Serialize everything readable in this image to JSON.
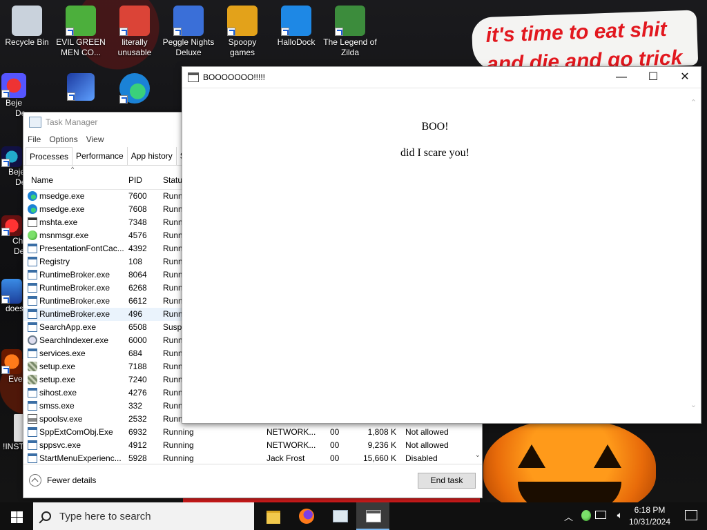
{
  "desktop": {
    "icons_row1": [
      {
        "label": "Recycle Bin",
        "color": "#c9d2dc"
      },
      {
        "label": "EVIL GREEN MEN CO...",
        "color": "#4caf3c"
      },
      {
        "label": "literally unusable",
        "color": "#db4437"
      },
      {
        "label": "Peggle Nights Deluxe",
        "color": "#3a6fd8"
      },
      {
        "label": "Spoopy games",
        "color": "#e3a21a"
      },
      {
        "label": "HalloDock",
        "color": "#1e88e5"
      },
      {
        "label": "The Legend of Zilda",
        "color": "#3c8c3c"
      }
    ],
    "partial_labels": [
      "Beje",
      "De",
      "Beje",
      "De",
      "Ch",
      "De",
      "does",
      "Ever",
      "!INST"
    ],
    "meme_text": [
      "it's time to eat shit",
      "and die and go trick"
    ]
  },
  "task_manager": {
    "title": "Task Manager",
    "menu": [
      "File",
      "Options",
      "View"
    ],
    "tabs": [
      "Processes",
      "Performance",
      "App history",
      "S"
    ],
    "columns": {
      "name": "Name",
      "pid": "PID",
      "status": "Status"
    },
    "rows": [
      {
        "icon": "edge",
        "name": "msedge.exe",
        "pid": "7600",
        "status": "Runn",
        "user": "",
        "cpu": "",
        "mem": "",
        "uac": ""
      },
      {
        "icon": "edge",
        "name": "msedge.exe",
        "pid": "7608",
        "status": "Runn",
        "user": "",
        "cpu": "",
        "mem": "",
        "uac": ""
      },
      {
        "icon": "app",
        "name": "mshta.exe",
        "pid": "7348",
        "status": "Runn",
        "user": "",
        "cpu": "",
        "mem": "",
        "uac": ""
      },
      {
        "icon": "msn",
        "name": "msnmsgr.exe",
        "pid": "4576",
        "status": "Runn",
        "user": "",
        "cpu": "",
        "mem": "",
        "uac": ""
      },
      {
        "icon": "win",
        "name": "PresentationFontCac...",
        "pid": "4392",
        "status": "Runn",
        "user": "",
        "cpu": "",
        "mem": "",
        "uac": ""
      },
      {
        "icon": "win",
        "name": "Registry",
        "pid": "108",
        "status": "Runn",
        "user": "",
        "cpu": "",
        "mem": "",
        "uac": ""
      },
      {
        "icon": "win",
        "name": "RuntimeBroker.exe",
        "pid": "8064",
        "status": "Runn",
        "user": "",
        "cpu": "",
        "mem": "",
        "uac": ""
      },
      {
        "icon": "win",
        "name": "RuntimeBroker.exe",
        "pid": "6268",
        "status": "Runn",
        "user": "",
        "cpu": "",
        "mem": "",
        "uac": ""
      },
      {
        "icon": "win",
        "name": "RuntimeBroker.exe",
        "pid": "6612",
        "status": "Runn",
        "user": "",
        "cpu": "",
        "mem": "",
        "uac": ""
      },
      {
        "icon": "win",
        "name": "RuntimeBroker.exe",
        "pid": "496",
        "status": "Runn",
        "user": "",
        "cpu": "",
        "mem": "",
        "uac": "",
        "selected": true
      },
      {
        "icon": "win",
        "name": "SearchApp.exe",
        "pid": "6508",
        "status": "Susp",
        "user": "",
        "cpu": "",
        "mem": "",
        "uac": ""
      },
      {
        "icon": "search",
        "name": "SearchIndexer.exe",
        "pid": "6000",
        "status": "Runn",
        "user": "",
        "cpu": "",
        "mem": "",
        "uac": ""
      },
      {
        "icon": "win",
        "name": "services.exe",
        "pid": "684",
        "status": "Runn",
        "user": "",
        "cpu": "",
        "mem": "",
        "uac": ""
      },
      {
        "icon": "setup",
        "name": "setup.exe",
        "pid": "7188",
        "status": "Runn",
        "user": "",
        "cpu": "",
        "mem": "",
        "uac": ""
      },
      {
        "icon": "setup",
        "name": "setup.exe",
        "pid": "7240",
        "status": "Runn",
        "user": "",
        "cpu": "",
        "mem": "",
        "uac": ""
      },
      {
        "icon": "win",
        "name": "sihost.exe",
        "pid": "4276",
        "status": "Runn",
        "user": "",
        "cpu": "",
        "mem": "",
        "uac": ""
      },
      {
        "icon": "win",
        "name": "smss.exe",
        "pid": "332",
        "status": "Runn",
        "user": "",
        "cpu": "",
        "mem": "",
        "uac": ""
      },
      {
        "icon": "print",
        "name": "spoolsv.exe",
        "pid": "2532",
        "status": "Runn",
        "user": "",
        "cpu": "",
        "mem": "",
        "uac": ""
      },
      {
        "icon": "win",
        "name": "SppExtComObj.Exe",
        "pid": "6932",
        "status": "Running",
        "user": "NETWORK...",
        "cpu": "00",
        "mem": "1,808 K",
        "uac": "Not allowed"
      },
      {
        "icon": "win",
        "name": "sppsvc.exe",
        "pid": "4912",
        "status": "Running",
        "user": "NETWORK...",
        "cpu": "00",
        "mem": "9,236 K",
        "uac": "Not allowed"
      },
      {
        "icon": "win",
        "name": "StartMenuExperienc...",
        "pid": "5928",
        "status": "Running",
        "user": "Jack Frost",
        "cpu": "00",
        "mem": "15,660 K",
        "uac": "Disabled"
      }
    ],
    "fewer_details": "Fewer details",
    "end_task": "End task"
  },
  "boo_window": {
    "title": "BOOOOOOO!!!!!",
    "heading": "BOO!",
    "message": "did I scare you!",
    "controls": {
      "minimize": "—",
      "maximize": "☐",
      "close": "✕"
    }
  },
  "taskbar": {
    "search_placeholder": "Type here to search",
    "time": "6:18 PM",
    "date": "10/31/2024"
  },
  "colors": {
    "accent": "#0078d7",
    "selected_row": "#eaf3fc",
    "meme_red": "#e2181f",
    "pumpkin": "#ff9a1a"
  }
}
